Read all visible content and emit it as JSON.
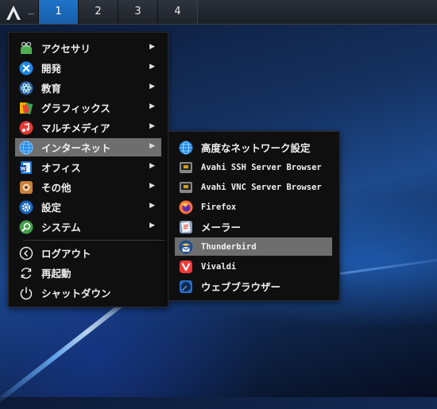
{
  "panel": {
    "launcher_icon": "arch-launcher-icon",
    "launcher_dash": "_",
    "workspaces": [
      "1",
      "2",
      "3",
      "4"
    ],
    "active_workspace": "1"
  },
  "main_menu": {
    "items": [
      {
        "label": "アクセサリ",
        "icon": "accessories-icon",
        "color": "#4caf50"
      },
      {
        "label": "開発",
        "icon": "development-icon",
        "color": "#1e88e5"
      },
      {
        "label": "教育",
        "icon": "education-icon",
        "color": "#3a7bd5"
      },
      {
        "label": "グラフィックス",
        "icon": "graphics-icon",
        "color": "#f4b400"
      },
      {
        "label": "マルチメディア",
        "icon": "multimedia-icon",
        "color": "#e53935"
      },
      {
        "label": "インターネット",
        "icon": "internet-icon",
        "color": "#1e88e5"
      },
      {
        "label": "オフィス",
        "icon": "office-icon",
        "color": "#1976d2"
      },
      {
        "label": "その他",
        "icon": "other-icon",
        "color": "#c8803a"
      },
      {
        "label": "設定",
        "icon": "settings-icon",
        "color": "#1565c0"
      },
      {
        "label": "システム",
        "icon": "system-icon",
        "color": "#43a047"
      }
    ],
    "actions": [
      {
        "label": "ログアウト",
        "icon": "logout-icon"
      },
      {
        "label": "再起動",
        "icon": "restart-icon"
      },
      {
        "label": "シャットダウン",
        "icon": "shutdown-icon"
      }
    ],
    "highlighted": "インターネット"
  },
  "sub_menu": {
    "items": [
      {
        "label": "高度なネットワーク設定",
        "icon": "network-settings-icon"
      },
      {
        "label": "Avahi SSH Server Browser",
        "icon": "avahi-ssh-icon"
      },
      {
        "label": "Avahi VNC Server Browser",
        "icon": "avahi-vnc-icon"
      },
      {
        "label": "Firefox",
        "icon": "firefox-icon"
      },
      {
        "label": "メーラー",
        "icon": "mailer-icon"
      },
      {
        "label": "Thunderbird",
        "icon": "thunderbird-icon"
      },
      {
        "label": "Vivaldi",
        "icon": "vivaldi-icon"
      },
      {
        "label": "ウェブブラウザー",
        "icon": "web-browser-icon"
      }
    ],
    "highlighted": "Thunderbird"
  },
  "colors": {
    "highlight": "#6e6e6e",
    "menu_bg": "#0f0f0f",
    "active_workspace": "#1f73c8"
  }
}
